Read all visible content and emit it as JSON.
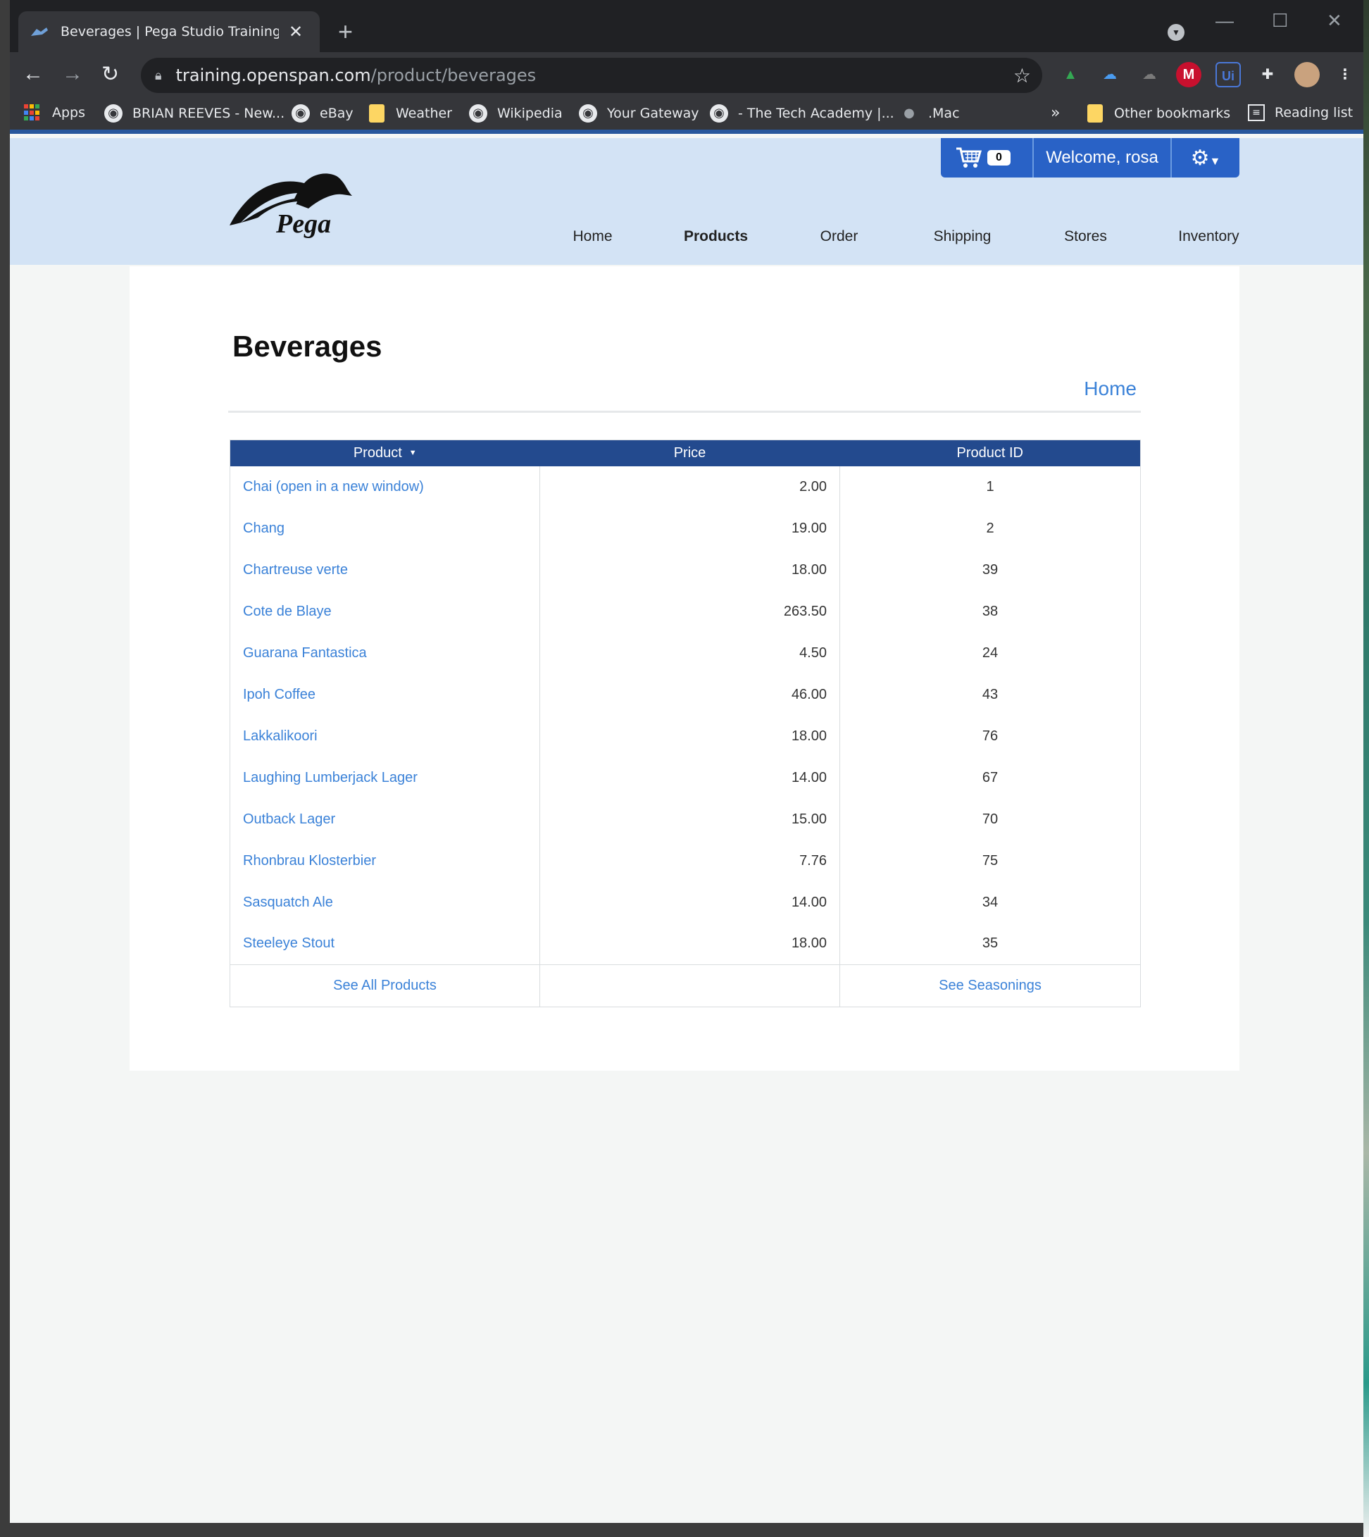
{
  "browser": {
    "tab_title": "Beverages | Pega Studio Training We",
    "tab_close": "✕",
    "new_tab": "+",
    "url_host": "training.openspan.com",
    "url_path": "/product/beverages",
    "window_controls": {
      "minimize": "—",
      "maximize": "☐",
      "close": "✕"
    },
    "extensions": [
      {
        "name": "google-drive-icon",
        "glyph": "▲"
      },
      {
        "name": "icloud-icon",
        "glyph": "☁"
      },
      {
        "name": "cloud-icon",
        "glyph": "☁"
      },
      {
        "name": "mcafee-icon",
        "glyph": "M"
      },
      {
        "name": "uipath-icon",
        "glyph": "Ui"
      },
      {
        "name": "puzzle-icon",
        "glyph": "✚"
      }
    ],
    "bookmarks": [
      {
        "label": "Apps"
      },
      {
        "label": "BRIAN REEVES - New..."
      },
      {
        "label": "eBay"
      },
      {
        "label": "Weather"
      },
      {
        "label": "Wikipedia"
      },
      {
        "label": "Your Gateway"
      },
      {
        "label": "- The Tech Academy |..."
      },
      {
        "label": ".Mac"
      }
    ],
    "overflow": "»",
    "other_bookmarks": "Other bookmarks",
    "reading_list": "Reading list"
  },
  "site": {
    "logo_text": "Pega",
    "cart_count": "0",
    "welcome": "Welcome, rosa",
    "nav": [
      "Home",
      "Products",
      "Order",
      "Shipping",
      "Stores",
      "Inventory"
    ],
    "active_nav": "Products"
  },
  "main": {
    "title": "Beverages",
    "home_link": "Home",
    "columns": [
      "Product",
      "Price",
      "Product ID"
    ],
    "rows": [
      {
        "product": "Chai  (open in a new window)",
        "price": "2.00",
        "id": "1"
      },
      {
        "product": "Chang",
        "price": "19.00",
        "id": "2"
      },
      {
        "product": "Chartreuse verte",
        "price": "18.00",
        "id": "39"
      },
      {
        "product": "Cote de Blaye",
        "price": "263.50",
        "id": "38"
      },
      {
        "product": "Guarana Fantastica",
        "price": "4.50",
        "id": "24"
      },
      {
        "product": "Ipoh Coffee",
        "price": "46.00",
        "id": "43"
      },
      {
        "product": "Lakkalikoori",
        "price": "18.00",
        "id": "76"
      },
      {
        "product": "Laughing Lumberjack Lager",
        "price": "14.00",
        "id": "67"
      },
      {
        "product": "Outback Lager",
        "price": "15.00",
        "id": "70"
      },
      {
        "product": "Rhonbrau Klosterbier",
        "price": "7.76",
        "id": "75"
      },
      {
        "product": "Sasquatch Ale",
        "price": "14.00",
        "id": "34"
      },
      {
        "product": "Steeleye Stout",
        "price": "18.00",
        "id": "35"
      }
    ],
    "footer_left": "See All Products",
    "footer_right": "See Seasonings"
  },
  "colors": {
    "header_bg": "#d3e3f5",
    "grid_header": "#234a8e",
    "link": "#3b82d8",
    "topbar": "#2962c6"
  }
}
